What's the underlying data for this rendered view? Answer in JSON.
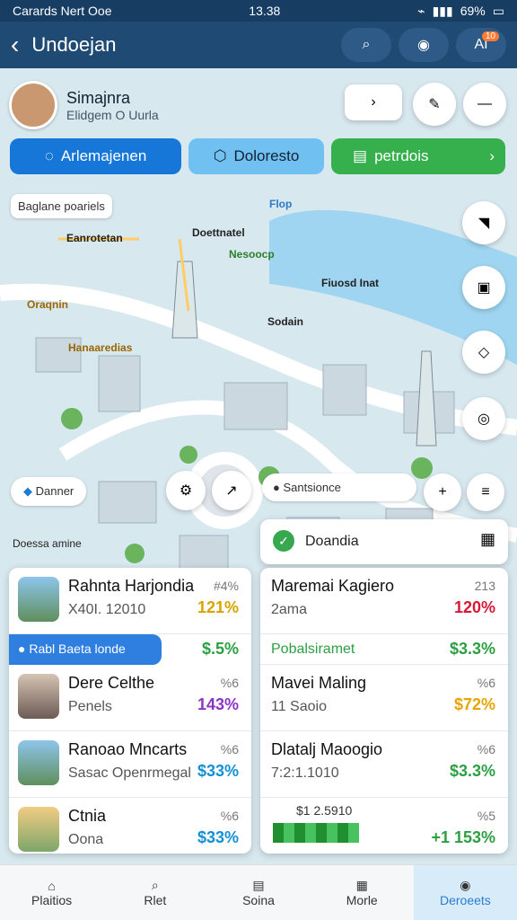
{
  "status": {
    "left": "Carards Nert Ooe",
    "time": "13.38",
    "battery": "69%"
  },
  "appbar": {
    "title": "Undoejan",
    "badge": "10",
    "right_label": "AI"
  },
  "profile": {
    "name": "Simajnra",
    "subtitle": "Elidgem O Uurla"
  },
  "tabs": [
    {
      "label": "Arlemajenen",
      "color": "#1677d8"
    },
    {
      "label": "Doloresto",
      "color": "#70c1f1"
    },
    {
      "label": "petrdois",
      "color": "#36b04d"
    }
  ],
  "map": {
    "search": "Baglane poariels",
    "top_label": "Flop",
    "places": [
      "Eanrotetan",
      "Doettnatel",
      "Nesoocp",
      "Oraqnin",
      "Fiuosd Inat",
      "Sodain",
      "Hanaaredias"
    ],
    "status_left": "Danner",
    "status_right": "Santsionce",
    "bottom_left": "Doessa amine"
  },
  "left_list": [
    {
      "title": "Rahnta Harjondia",
      "sub": "X40I. 12010",
      "small": "#4%",
      "value": "121%",
      "color": "#d7a300"
    },
    {
      "title": "Rabl Baeta londe",
      "sub": "",
      "small": "",
      "value": "$.5%",
      "color": "#2c9f42"
    },
    {
      "title": "Dere Celthe",
      "sub": "Penels",
      "small": "%6",
      "value": "143%",
      "color": "#8a34c5"
    },
    {
      "title": "Ranoao Mncarts",
      "sub": "Sasac Openrmegal",
      "small": "%6",
      "value": "$33%",
      "color": "#1590d4"
    },
    {
      "title": "Ctnia",
      "sub": "Oona",
      "small": "%6",
      "value": "$33%",
      "color": "#1590d4"
    }
  ],
  "right_header": {
    "title": "Doandia"
  },
  "right_list": [
    {
      "title": "Maremai Kagiero",
      "sub": "2ama",
      "small": "213",
      "value": "120%",
      "color": "#d71935"
    },
    {
      "title": "Pobalsiramet",
      "sub": "",
      "small": "",
      "value": "$3.3%",
      "color": "#2c9f42"
    },
    {
      "title": "Mavei Maling",
      "sub": "11 Saoio",
      "small": "%6",
      "value": "$72%",
      "color": "#e8a400"
    },
    {
      "title": "Dlatalj Maoogio",
      "sub": "7:2:1.1010",
      "small": "%6",
      "value": "$3.3%",
      "color": "#2c9f42"
    },
    {
      "title": "$1 2.5910",
      "sub": "",
      "small": "%5",
      "value": "+1 153%",
      "color": "#2c9f42"
    }
  ],
  "nav": [
    {
      "label": "Plaitios",
      "icon": "home-icon"
    },
    {
      "label": "Rlet",
      "icon": "search-icon"
    },
    {
      "label": "Soina",
      "icon": "document-icon"
    },
    {
      "label": "Morle",
      "icon": "stack-icon"
    },
    {
      "label": "Deroeets",
      "icon": "person-icon"
    }
  ]
}
